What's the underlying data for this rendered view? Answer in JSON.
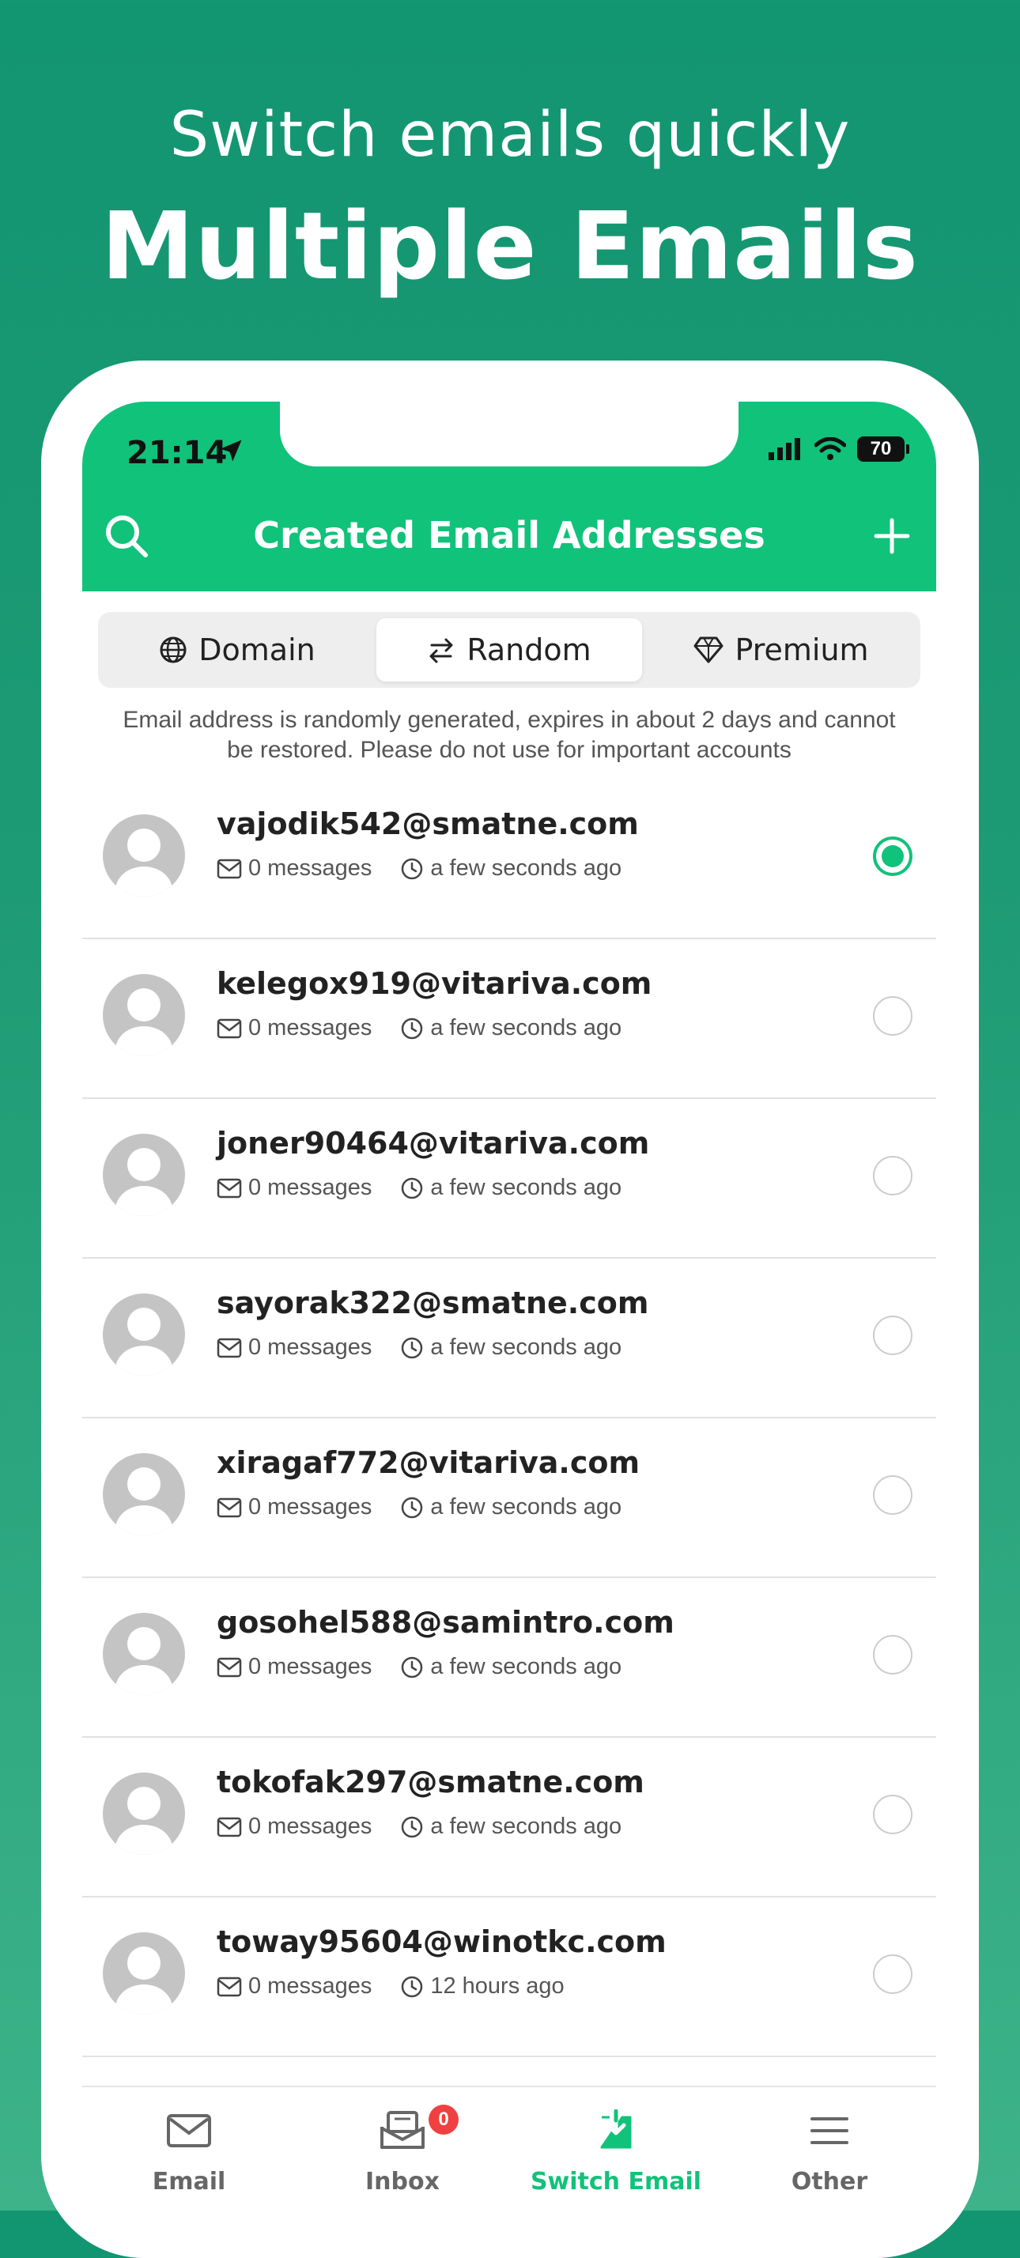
{
  "headline": {
    "subtitle": "Switch emails quickly",
    "title": "Multiple Emails"
  },
  "status_bar": {
    "time": "21:14",
    "battery": "70"
  },
  "appbar": {
    "title": "Created Email Addresses"
  },
  "segments": [
    {
      "label": "Domain",
      "icon": "globe-icon",
      "active": false
    },
    {
      "label": "Random",
      "icon": "swap-icon",
      "active": true
    },
    {
      "label": "Premium",
      "icon": "diamond-icon",
      "active": false
    }
  ],
  "notice": "Email address is randomly generated, expires in about 2 days and cannot be restored. Please do not use for important accounts",
  "emails": [
    {
      "address": "vajodik542@smatne.com",
      "messages": "0 messages",
      "time": "a few seconds ago",
      "selected": true
    },
    {
      "address": "kelegox919@vitariva.com",
      "messages": "0 messages",
      "time": "a few seconds ago",
      "selected": false
    },
    {
      "address": "joner90464@vitariva.com",
      "messages": "0 messages",
      "time": "a few seconds ago",
      "selected": false
    },
    {
      "address": "sayorak322@smatne.com",
      "messages": "0 messages",
      "time": "a few seconds ago",
      "selected": false
    },
    {
      "address": "xiragaf772@vitariva.com",
      "messages": "0 messages",
      "time": "a few seconds ago",
      "selected": false
    },
    {
      "address": "gosohel588@samintro.com",
      "messages": "0 messages",
      "time": "a few seconds ago",
      "selected": false
    },
    {
      "address": "tokofak297@smatne.com",
      "messages": "0 messages",
      "time": "a few seconds ago",
      "selected": false
    },
    {
      "address": "toway95604@winotkc.com",
      "messages": "0 messages",
      "time": "12 hours ago",
      "selected": false
    }
  ],
  "tabbar": [
    {
      "label": "Email",
      "icon": "mail-icon",
      "active": false
    },
    {
      "label": "Inbox",
      "icon": "inbox-icon",
      "active": false,
      "badge": "0"
    },
    {
      "label": "Switch Email",
      "icon": "switch-email-icon",
      "active": true
    },
    {
      "label": "Other",
      "icon": "menu-icon",
      "active": false
    }
  ],
  "colors": {
    "background": "#129571",
    "accent": "#11c27a",
    "badge": "#ef4141"
  }
}
